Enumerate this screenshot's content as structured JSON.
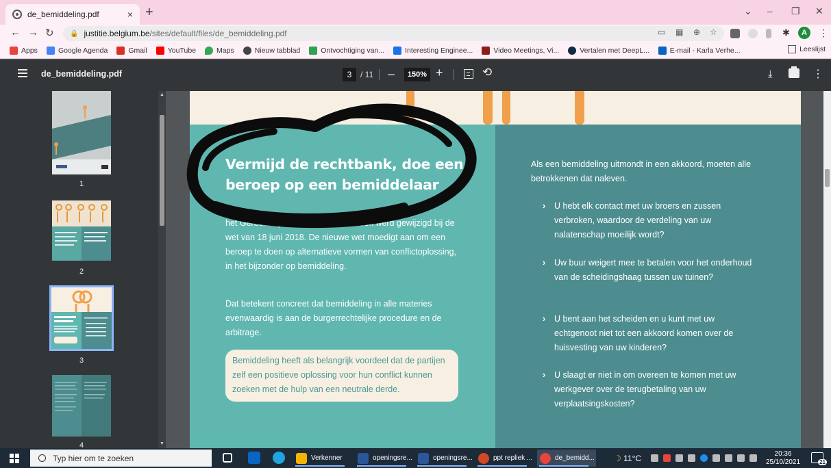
{
  "browser": {
    "tab_title": "de_bemiddeling.pdf",
    "tab_close": "×",
    "new_tab": "+",
    "url_host": "justitie.belgium.be",
    "url_path": "/sites/default/files/de_bemiddeling.pdf",
    "profile_initial": "A"
  },
  "bookmarks": [
    {
      "label": "Apps",
      "color": "#e8453c"
    },
    {
      "label": "Google Agenda",
      "color": "#4285f4"
    },
    {
      "label": "Gmail",
      "color": "#d93025"
    },
    {
      "label": "YouTube",
      "color": "#ff0000"
    },
    {
      "label": "Maps",
      "color": "#34a853"
    },
    {
      "label": "Nieuw tabblad",
      "color": "#444444"
    },
    {
      "label": "Ontvochtiging van...",
      "color": "#2ea44f"
    },
    {
      "label": "Interesting Enginee...",
      "color": "#1a73e8"
    },
    {
      "label": "Video Meetings, Vi...",
      "color": "#8b1d1d"
    },
    {
      "label": "Vertalen met DeepL...",
      "color": "#0f2b46"
    },
    {
      "label": "E-mail - Karla Verhe...",
      "color": "#0a64c2"
    }
  ],
  "reading_list": "Leeslijst",
  "pdf": {
    "filename": "de_bemiddeling.pdf",
    "current_page": "3",
    "total_pages": "/ 11",
    "zoom": "150%"
  },
  "thumbnails": [
    {
      "number": "1"
    },
    {
      "number": "2"
    },
    {
      "number": "3"
    },
    {
      "number": "4"
    }
  ],
  "document": {
    "heading": "Vermijd de rechtbank, doe een beroep op een bemiddelaar",
    "paragraph1": "het Gerechtelijk Wetboek. Dat wetboek werd gewijzigd bij de wet van 18 juni 2018. De nieuwe wet moedigt aan om een beroep te doen op alternatieve vormen van conflictoplossing, in het bijzonder op bemiddeling.",
    "paragraph2": "Dat betekent concreet dat bemiddeling in alle materies evenwaardig is aan de burgerrechtelijke procedure en de arbitrage.",
    "callout": "Bemiddeling heeft als belangrijk voordeel dat de partijen zelf een positieve oplossing voor hun conflict kunnen zoeken met de hulp van een neutrale derde.",
    "right_intro": "Als een bemiddeling uitmondt in een akkoord, moeten alle betrokkenen dat naleven.",
    "bullets": [
      "U hebt elk contact met uw broers en zussen verbroken, waardoor de verdeling van uw nalatenschap moeilijk wordt?",
      "Uw buur weigert mee te betalen voor het onderhoud van de scheidingshaag tussen uw tuinen?",
      "U bent aan het scheiden en u kunt met uw echtgenoot niet tot een akkoord komen over de huisvesting van uw kinderen?",
      "U slaagt er niet in om overeen te komen met uw werkgever over de terugbetaling van uw verplaatsingskosten?"
    ]
  },
  "taskbar": {
    "search_placeholder": "Typ hier om te zoeken",
    "apps": [
      {
        "label": "Verkenner",
        "color": "#f4b400"
      },
      {
        "label": "openingsre...",
        "color": "#2b579a"
      },
      {
        "label": "openingsre...",
        "color": "#2b579a"
      },
      {
        "label": "ppt repliek ...",
        "color": "#d24726"
      },
      {
        "label": "de_bemidd...",
        "color": "#e8453c"
      }
    ],
    "temperature": "11°C",
    "time": "20:36",
    "date": "25/10/2021",
    "notification_count": "21"
  },
  "colors": {
    "tab_strip": "#f7d3e3",
    "page_teal": "#5fb7b0",
    "page_dark_teal": "#4e8d8f",
    "page_cream": "#f7efe2",
    "accent_orange": "#f0a04a"
  }
}
